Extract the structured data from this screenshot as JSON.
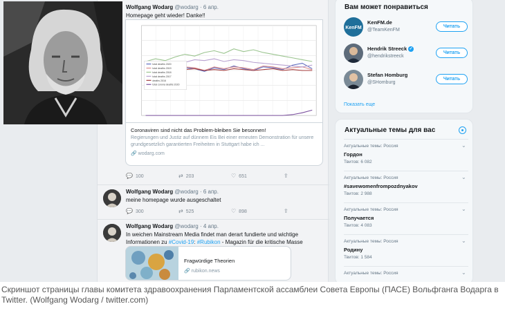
{
  "portrait": {
    "name": "portrait-photo"
  },
  "timeline": {
    "tweets": [
      {
        "name": "Wolfgang Wodarg",
        "meta": "@wodarg · 6 апр.",
        "text": "Homepage geht wieder! Danke!!",
        "card": {
          "title": "Coronaviren sind nicht das Problem-bleiben Sie besonnen!",
          "desc": "Regierungen und Justiz auf dünnem Eis Bei einer erneuten Demonstration für unsere grundgesetzlich garantierten Freiheiten in Stuttgart habe ich ...",
          "url": "wodarg.com"
        },
        "replies": "100",
        "retweets": "203",
        "likes": "651"
      },
      {
        "name": "Wolfgang Wodarg",
        "meta": "@wodarg · 6 апр.",
        "text": "meine homepage wurde ausgeschaltet",
        "replies": "300",
        "retweets": "525",
        "likes": "898"
      },
      {
        "name": "Wolfgang Wodarg",
        "meta": "@wodarg · 4 апр.",
        "text_a": "In weichen Mainstream Media findet man derart fundierte und wichtige",
        "text_b_pre": "Informationen zu ",
        "hashtag1": "#Covid-19",
        "text_b_mid": ": ",
        "hashtag2": "#Rubikon",
        "text_b_post": " - Magazin für die kritische Masse",
        "card": {
          "title": "Fragwürdige Theorien",
          "url": "rubikon.news"
        }
      }
    ]
  },
  "chart_data": {
    "type": "line",
    "series": [
      {
        "name": "total deaths 2020",
        "color": "#5b6abf",
        "values": [
          52,
          50,
          54,
          51,
          53,
          52,
          49,
          53,
          51,
          55,
          52,
          50,
          54,
          53,
          51,
          56,
          58,
          52
        ]
      },
      {
        "name": "total deaths 2019",
        "color": "#d98a8a",
        "values": [
          53,
          51,
          55,
          52,
          54,
          53,
          50,
          54,
          52,
          54,
          53,
          51,
          55,
          54,
          52,
          53,
          54,
          51
        ]
      },
      {
        "name": "total deaths 2018",
        "color": "#9ac48e",
        "values": [
          60,
          63,
          61,
          65,
          68,
          66,
          70,
          72,
          69,
          74,
          71,
          73,
          70,
          68,
          66,
          64,
          62,
          60
        ]
      },
      {
        "name": "total deaths 2017",
        "color": "#b7a0cf",
        "values": [
          57,
          55,
          58,
          60,
          59,
          62,
          61,
          63,
          60,
          62,
          61,
          59,
          58,
          57,
          56,
          55,
          54,
          56
        ]
      },
      {
        "name": "deaths 2016",
        "color": "#a33838",
        "values": [
          51,
          50,
          52,
          50,
          51,
          52,
          50,
          51,
          50,
          52,
          51,
          50,
          51,
          52,
          50,
          51,
          50,
          50
        ]
      },
      {
        "name": "total corona deaths 2020",
        "color": "#7a4f9e",
        "values": [
          0,
          0,
          0,
          0,
          0,
          0,
          0,
          0,
          0,
          0,
          0,
          0,
          0,
          0,
          0,
          1,
          3,
          6
        ]
      }
    ],
    "ylim": [
      0,
      100
    ]
  },
  "sidebar": {
    "who_title": "Вам может понравиться",
    "accounts": [
      {
        "name": "KenFM.de",
        "handle": "@TeamKenFM",
        "button": "Читать",
        "avatar_text": "KenFM"
      },
      {
        "name": "Hendrik Streeck",
        "handle": "@hendrikstreeck",
        "button": "Читать",
        "verified": "✓"
      },
      {
        "name": "Stefan Homburg",
        "handle": "@SHomburg",
        "button": "Читать"
      }
    ],
    "show_more": "Показать еще",
    "trends_title": "Актуальные темы для вас",
    "trends": [
      {
        "cat": "Актуальные темы: Россия",
        "name": "Гордон",
        "count": "Твитов: 6 082"
      },
      {
        "cat": "Актуальные темы: Россия",
        "name": "#savewomenfrompozdnyakov",
        "count": "Твитов: 2 988"
      },
      {
        "cat": "Актуальные темы: Россия",
        "name": "Получается",
        "count": "Твитов: 4 083"
      },
      {
        "cat": "Актуальные темы: Россия",
        "name": "Родину",
        "count": "Твитов: 1 584"
      },
      {
        "cat": "Актуальные темы: Россия",
        "name": "",
        "count": ""
      }
    ]
  },
  "caption": "Скриншот страницы главы комитета здравоохранения Парламентской ассамблеи Совета Европы (ПАСЕ) Вольфганга Водарга в Twitter. (Wolfgang Wodarg / twitter.com)"
}
